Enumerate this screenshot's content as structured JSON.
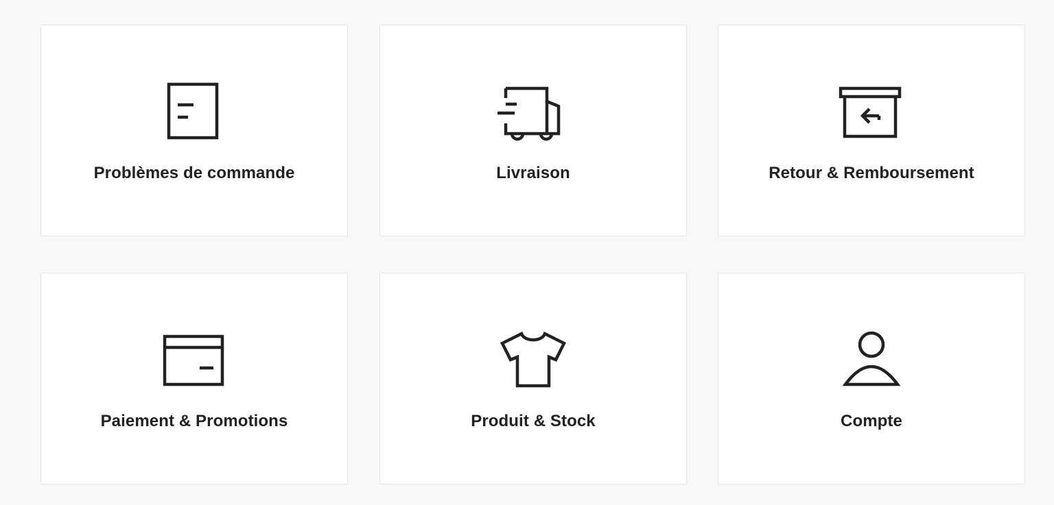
{
  "categories": [
    {
      "label": "Problèmes de commande",
      "icon": "order-document-icon"
    },
    {
      "label": "Livraison",
      "icon": "delivery-truck-icon"
    },
    {
      "label": "Retour & Remboursement",
      "icon": "return-box-icon"
    },
    {
      "label": "Paiement & Promotions",
      "icon": "credit-card-icon"
    },
    {
      "label": "Produit & Stock",
      "icon": "tshirt-icon"
    },
    {
      "label": "Compte",
      "icon": "user-account-icon"
    }
  ],
  "colors": {
    "background": "#f8f8f8",
    "card": "#ffffff",
    "card_border": "#e6e6e6",
    "icon_stroke": "#222222",
    "text": "#222222"
  }
}
